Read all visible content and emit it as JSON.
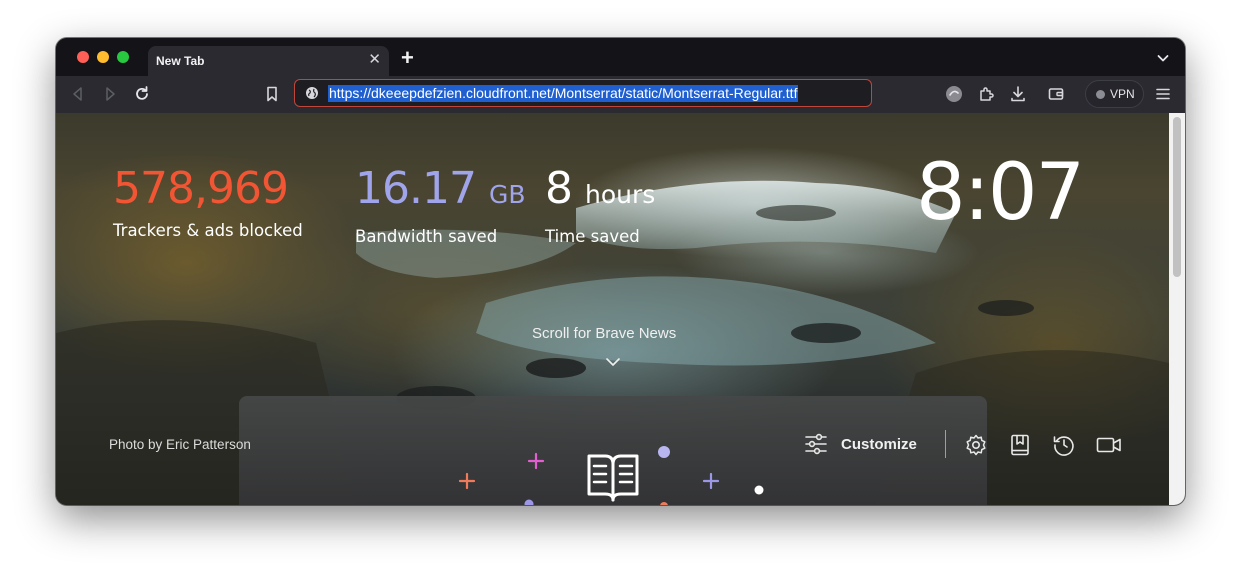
{
  "window": {
    "tab_title": "New Tab",
    "tab_close_icon": "close-icon",
    "new_tab_icon": "plus-icon"
  },
  "toolbar": {
    "url": "https://dkeeepdefzien.cloudfront.net/Montserrat/static/Montserrat-Regular.ttf",
    "vpn_label": "VPN"
  },
  "stats": {
    "trackers_value": "578,969",
    "trackers_label": "Trackers & ads blocked",
    "bandwidth_value": "16.17",
    "bandwidth_unit": "GB",
    "bandwidth_label": "Bandwidth saved",
    "time_value": "8",
    "time_unit": "hours",
    "time_label": "Time saved"
  },
  "clock": "8:07",
  "scroll_news": "Scroll for Brave News",
  "photo_credit": {
    "prefix": "Photo by ",
    "author": "Eric Patterson"
  },
  "customize_label": "Customize",
  "colors": {
    "trackers": "#f25533",
    "bandwidth": "#a0a5eb",
    "url_highlight": "#1f5fcf",
    "address_border": "#c0463c"
  }
}
